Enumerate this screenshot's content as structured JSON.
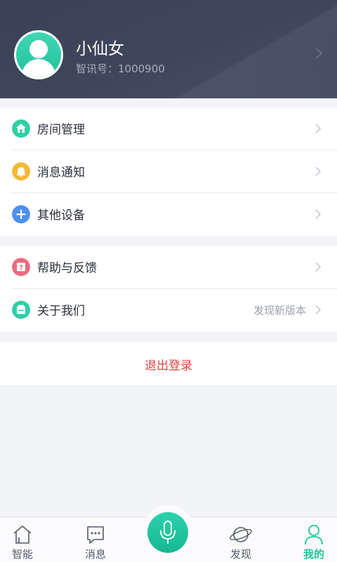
{
  "profile": {
    "username": "小仙女",
    "id_label": "智讯号：1000900"
  },
  "menu_group_1": [
    {
      "label": "房间管理",
      "icon": "home-icon",
      "color": "#2fcfa5"
    },
    {
      "label": "消息通知",
      "icon": "bell-icon",
      "color": "#f7b733"
    },
    {
      "label": "其他设备",
      "icon": "plus-icon",
      "color": "#4e8ff0"
    }
  ],
  "menu_group_2": [
    {
      "label": "帮助与反馈",
      "icon": "help-icon",
      "color": "#ec6a7c"
    },
    {
      "label": "关于我们",
      "icon": "info-icon",
      "color": "#2fcfa5",
      "aside": "发现新版本"
    }
  ],
  "logout": {
    "label": "退出登录"
  },
  "tabbar": {
    "tabs": [
      {
        "label": "智能",
        "icon": "home-outline-icon"
      },
      {
        "label": "消息",
        "icon": "chat-icon"
      },
      {
        "label": "发现",
        "icon": "planet-icon"
      },
      {
        "label": "我的",
        "icon": "person-icon",
        "active": true
      }
    ],
    "voice": {
      "icon": "microphone-icon"
    }
  },
  "colors": {
    "header_bg": "#3f465c",
    "accent": "#1fc39b",
    "logout": "#e04343",
    "page_bg": "#f3f4f8"
  }
}
